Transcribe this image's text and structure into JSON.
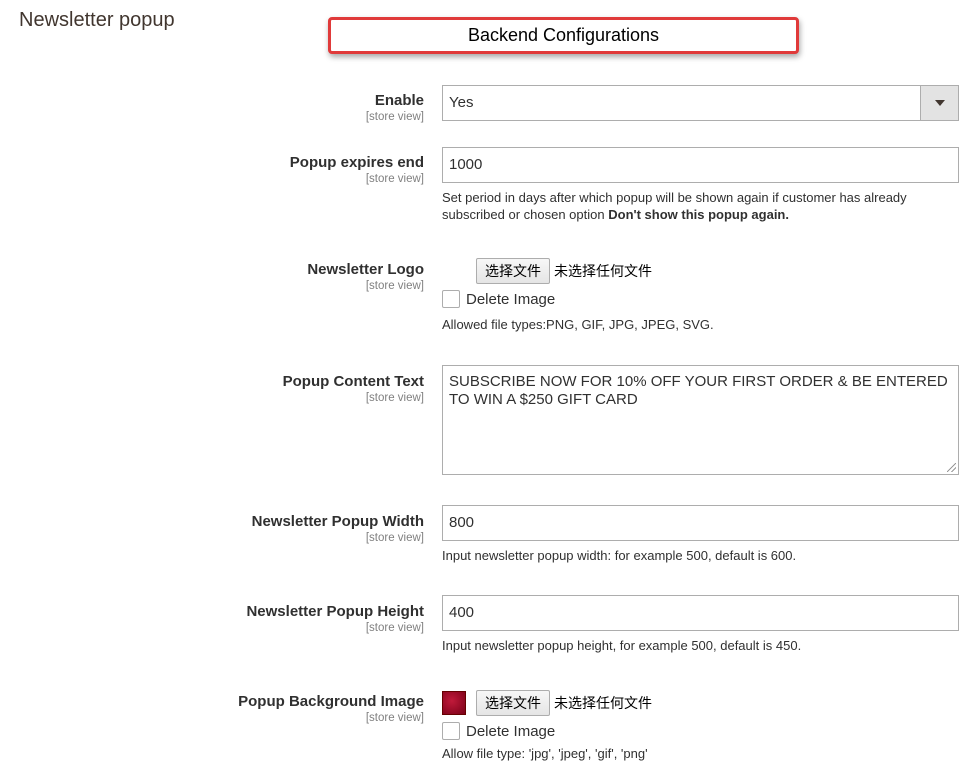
{
  "section": {
    "title": "Newsletter popup"
  },
  "callout": {
    "text": "Backend Configurations"
  },
  "scope_label": "[store view]",
  "fields": {
    "enable": {
      "label": "Enable",
      "scope": "[store view]",
      "value": "Yes"
    },
    "expires": {
      "label": "Popup expires end",
      "scope": "[store view]",
      "value": "1000",
      "note": "Set period in days after which popup will be shown again if customer has already subscribed or chosen option",
      "note_bold": "Don't show this popup again."
    },
    "logo": {
      "label": "Newsletter Logo",
      "scope": "[store view]",
      "button": "选择文件",
      "status": "未选择任何文件",
      "delete": "Delete Image",
      "note": "Allowed file types:PNG, GIF, JPG, JPEG, SVG."
    },
    "content": {
      "label": "Popup Content Text",
      "scope": "[store view]",
      "value": "SUBSCRIBE NOW FOR 10% OFF YOUR FIRST ORDER & BE ENTERED TO WIN A $250 GIFT CARD"
    },
    "width": {
      "label": "Newsletter Popup Width",
      "scope": "[store view]",
      "value": "800",
      "note": "Input newsletter popup width: for example 500, default is 600."
    },
    "height": {
      "label": "Newsletter Popup Height",
      "scope": "[store view]",
      "value": "400",
      "note": "Input newsletter popup height, for example 500, default is 450."
    },
    "background": {
      "label": "Popup Background Image",
      "scope": "[store view]",
      "button": "选择文件",
      "status": "未选择任何文件",
      "delete": "Delete Image",
      "note": "Allow file type: 'jpg', 'jpeg', 'gif', 'png'"
    }
  },
  "colors": {
    "callout_border": "#e03a3a",
    "label_text": "#303030",
    "scope_text": "#808080",
    "swatch": "#a0102a"
  }
}
